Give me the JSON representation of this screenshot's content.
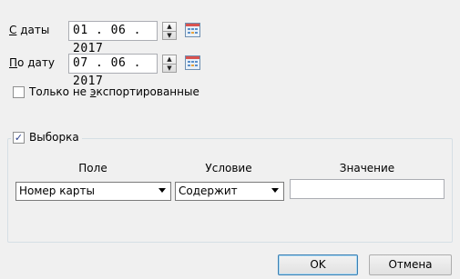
{
  "date_from": {
    "label_underlined": "С",
    "label_rest": " даты",
    "value": "01 . 06 . 2017"
  },
  "date_to": {
    "label_underlined": "П",
    "label_rest": "о дату",
    "value": "07 . 06 . 2017"
  },
  "only_not_exported": {
    "label_prefix": "Только не ",
    "label_underlined": "э",
    "label_suffix": "кспортированные",
    "checked": false
  },
  "selection": {
    "label": "Выборка",
    "checked": true,
    "columns": {
      "field": "Поле",
      "condition": "Условие",
      "value": "Значение"
    },
    "field_value": "Номер карты",
    "condition_value": "Содержит",
    "value_text": ""
  },
  "buttons": {
    "ok": "OK",
    "cancel": "Отмена"
  },
  "colors": {
    "window_bg": "#f0f0f0",
    "default_button_border": "#3c7fb1"
  },
  "icons": {
    "spin": "up-down-spinner-icon",
    "calendar": "calendar-icon",
    "check": "checkmark-icon"
  }
}
